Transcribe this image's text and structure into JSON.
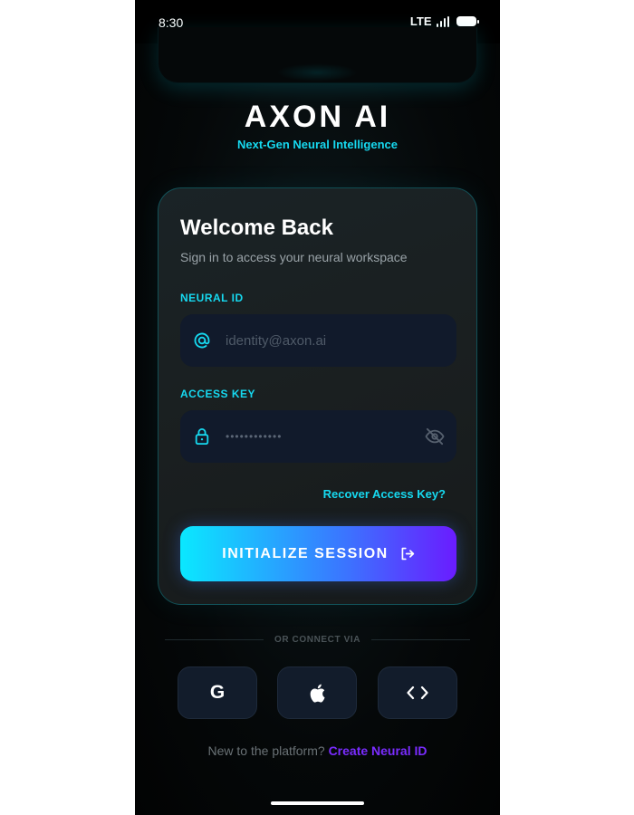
{
  "status_bar": {
    "time": "8:30",
    "network": "LTE"
  },
  "brand": {
    "title": "AXON AI",
    "subtitle": "Next-Gen Neural Intelligence"
  },
  "login": {
    "title": "Welcome Back",
    "subtitle": "Sign in to access your neural workspace",
    "neural_id_label": "NEURAL ID",
    "neural_id_placeholder": "identity@axon.ai",
    "access_key_label": "ACCESS KEY",
    "access_key_masked": "••••••••••••",
    "recover_link": "Recover Access Key?",
    "submit_label": "INITIALIZE SESSION"
  },
  "social": {
    "divider_text": "OR CONNECT VIA",
    "providers": [
      {
        "name": "google",
        "glyph": "G",
        "icon": "google-icon"
      },
      {
        "name": "apple",
        "icon": "apple-icon"
      },
      {
        "name": "code",
        "icon": "code-icon"
      }
    ]
  },
  "signup": {
    "prefix": "New to the platform?",
    "link": "Create Neural ID"
  },
  "colors": {
    "accent_cyan": "#16d9f0",
    "accent_purple": "#7a2cff",
    "button_gradient_start": "#0ae8ff",
    "button_gradient_end": "#6a1cff"
  }
}
